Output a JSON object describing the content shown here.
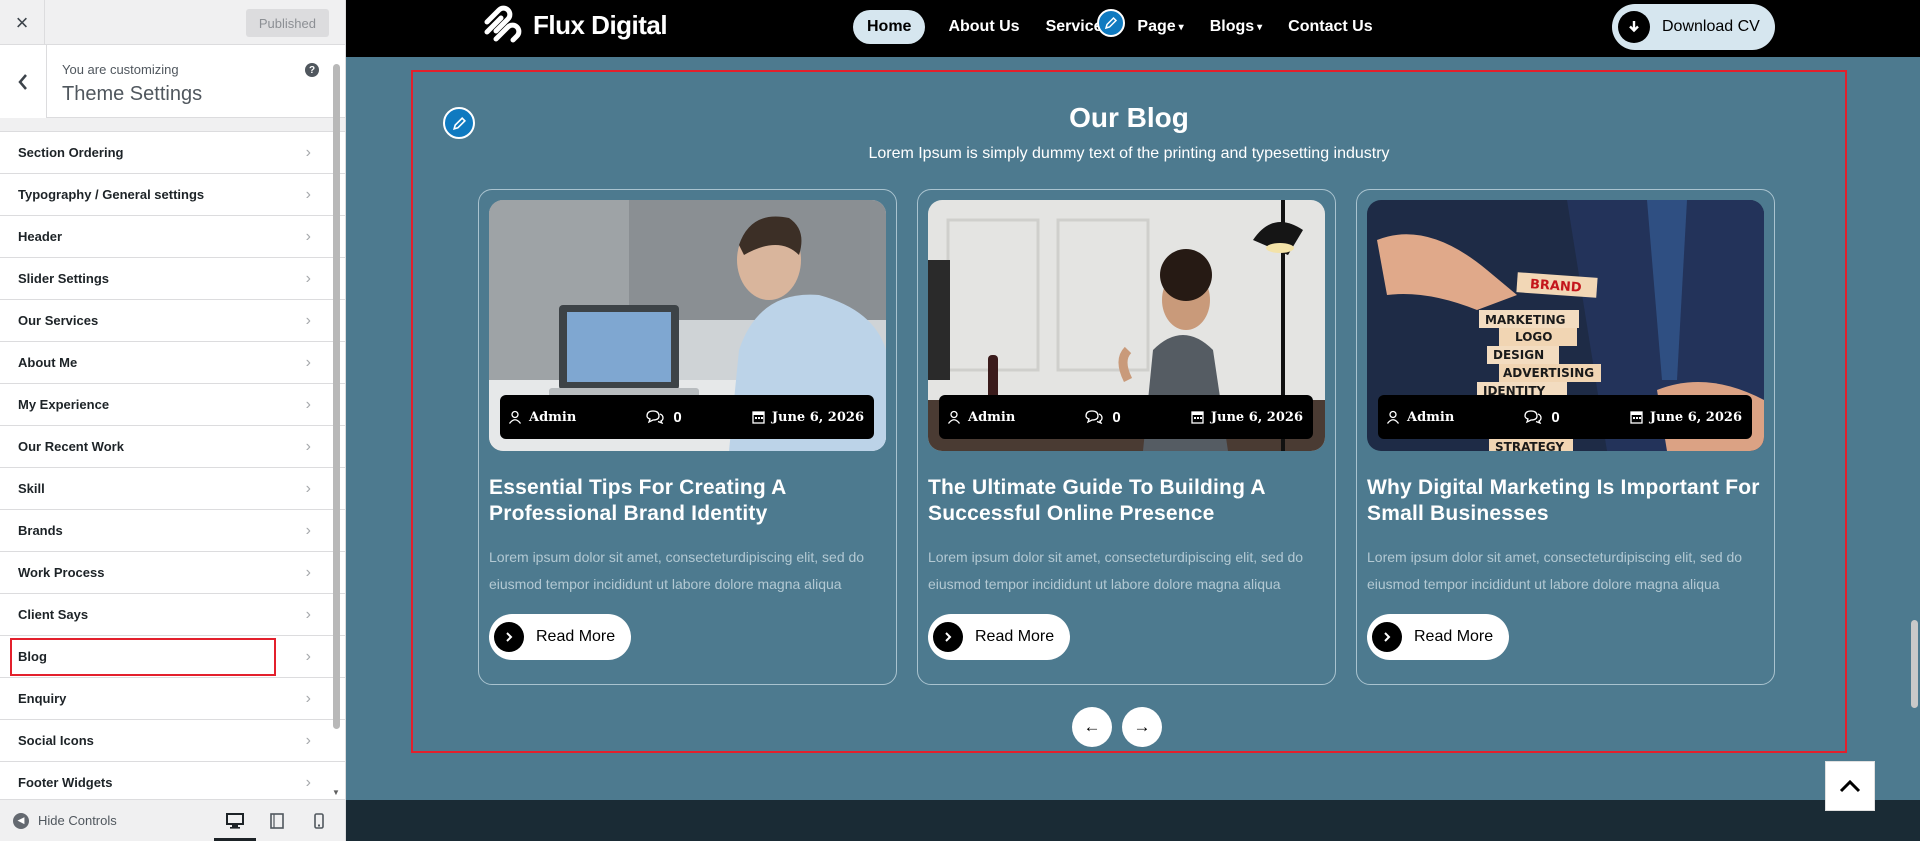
{
  "customizer": {
    "close_label": "×",
    "published_label": "Published",
    "customizing_label": "You are customizing",
    "theme_title": "Theme Settings",
    "help_label": "?",
    "sections": [
      {
        "label": "Section Ordering"
      },
      {
        "label": "Typography / General settings"
      },
      {
        "label": "Header"
      },
      {
        "label": "Slider Settings"
      },
      {
        "label": "Our Services"
      },
      {
        "label": "About Me"
      },
      {
        "label": "My Experience"
      },
      {
        "label": "Our Recent Work"
      },
      {
        "label": "Skill"
      },
      {
        "label": "Brands"
      },
      {
        "label": "Work Process"
      },
      {
        "label": "Client Says"
      },
      {
        "label": "Blog"
      },
      {
        "label": "Enquiry"
      },
      {
        "label": "Social Icons"
      },
      {
        "label": "Footer Widgets"
      }
    ],
    "active_section": "Blog",
    "hide_controls_label": "Hide Controls",
    "devices": [
      "desktop-icon",
      "tablet-icon",
      "mobile-icon"
    ]
  },
  "site": {
    "logo_text": "Flux Digital",
    "menu": [
      {
        "label": "Home",
        "active": true
      },
      {
        "label": "About Us"
      },
      {
        "label": "Services"
      },
      {
        "label": "Page",
        "dropdown": true
      },
      {
        "label": "Blogs",
        "dropdown": true
      },
      {
        "label": "Contact Us"
      }
    ],
    "cta_label": "Download CV",
    "blog": {
      "title": "Our Blog",
      "subtitle": "Lorem Ipsum is simply dummy text of the printing and typesetting industry",
      "posts": [
        {
          "author": "Admin",
          "comments": "0",
          "date": "June 6, 2026",
          "title": "Essential Tips For Creating A Professional Brand Identity",
          "excerpt": "Lorem ipsum dolor sit amet, consecteturdipiscing elit, sed do eiusmod tempor incididunt ut labore dolore magna aliqua",
          "button": "Read More"
        },
        {
          "author": "Admin",
          "comments": "0",
          "date": "June 6, 2026",
          "title": "The Ultimate Guide To Building A Successful Online Presence",
          "excerpt": "Lorem ipsum dolor sit amet, consecteturdipiscing elit, sed do eiusmod tempor incididunt ut labore dolore magna aliqua",
          "button": "Read More"
        },
        {
          "author": "Admin",
          "comments": "0",
          "date": "June 6, 2026",
          "title": "Why Digital Marketing Is Important For Small Businesses",
          "excerpt": "Lorem ipsum dolor sit amet, consecteturdipiscing elit, sed do eiusmod tempor incididunt ut labore dolore magna aliqua",
          "button": "Read More",
          "image_words": [
            "BRAND",
            "MARKETING",
            "LOGO",
            "DESIGN",
            "ADVERTISING",
            "IDENTITY",
            "STRATEGY"
          ]
        }
      ],
      "prev_label": "←",
      "next_label": "→"
    },
    "colors": {
      "section_bg": "#4d7a8f",
      "nav_bg": "#000000",
      "accent_pill": "#d6e6ef",
      "edit_blue": "#0f7ac0",
      "highlight_red": "#e3202c"
    }
  }
}
